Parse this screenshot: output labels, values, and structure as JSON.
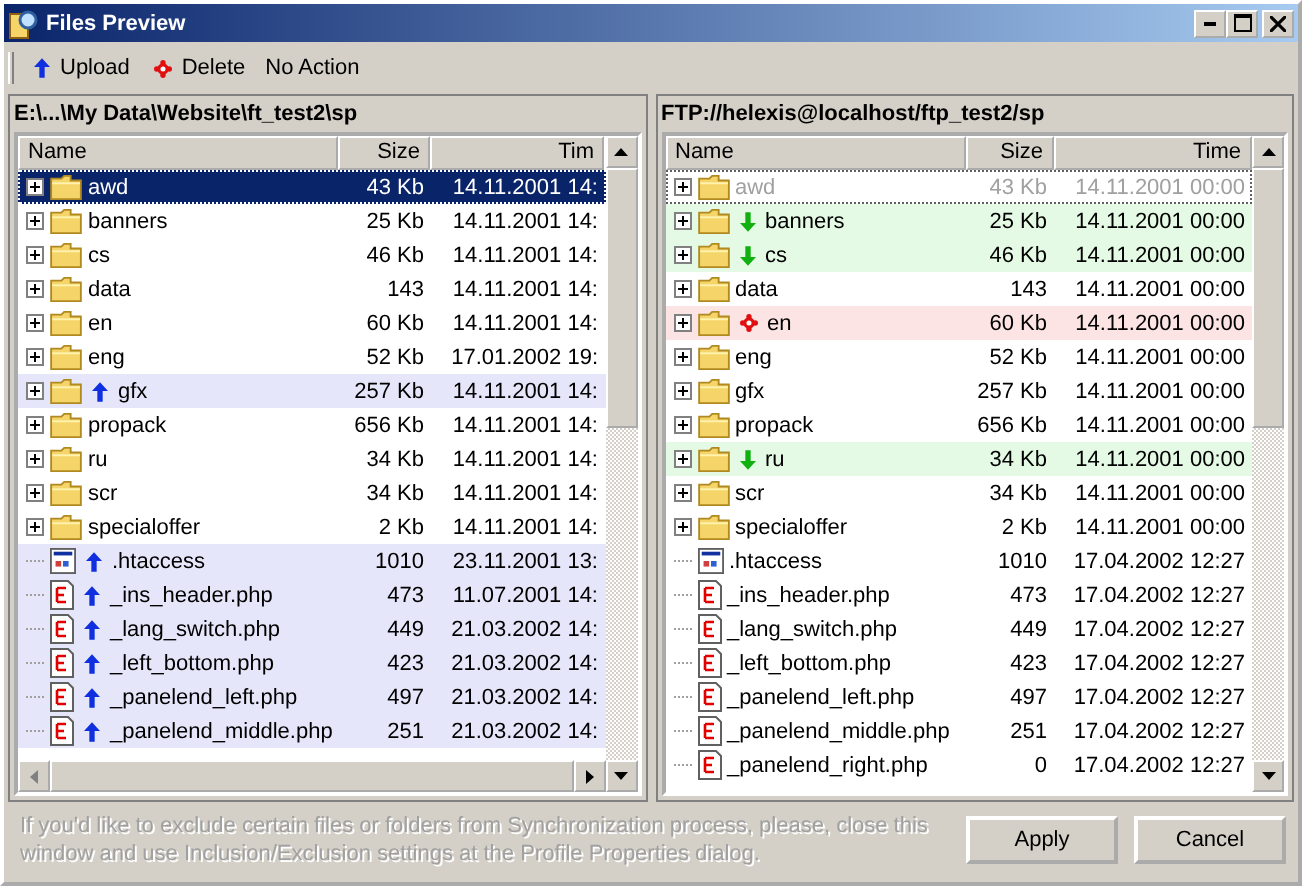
{
  "window": {
    "title": "Files Preview"
  },
  "toolbar": [
    {
      "label": "Upload",
      "kind": "upload"
    },
    {
      "label": "Delete",
      "kind": "delete"
    },
    {
      "label": "No Action",
      "kind": "none"
    }
  ],
  "panes": [
    {
      "path": "E:\\...\\My Data\\Website\\ft_test2\\sp",
      "columns": [
        "Name",
        "Size",
        "Tim"
      ],
      "hscroll": true,
      "rows": [
        {
          "name": "awd",
          "size": "43 Kb",
          "time": "14.11.2001 14:",
          "kind": "folder",
          "selected": true
        },
        {
          "name": "banners",
          "size": "25 Kb",
          "time": "14.11.2001 14:",
          "kind": "folder",
          "selected": false
        },
        {
          "name": "cs",
          "size": "46 Kb",
          "time": "14.11.2001 14:",
          "kind": "folder",
          "selected": false
        },
        {
          "name": "data",
          "size": "143",
          "time": "14.11.2001 14:",
          "kind": "folder",
          "selected": false
        },
        {
          "name": "en",
          "size": "60 Kb",
          "time": "14.11.2001 14:",
          "kind": "folder",
          "selected": false
        },
        {
          "name": "eng",
          "size": "52 Kb",
          "time": "17.01.2002 19:",
          "kind": "folder",
          "selected": false
        },
        {
          "name": "gfx",
          "size": "257 Kb",
          "time": "14.11.2001 14:",
          "kind": "folder",
          "selected": false,
          "action": {
            "kind": "upload"
          }
        },
        {
          "name": "propack",
          "size": "656 Kb",
          "time": "14.11.2001 14:",
          "kind": "folder",
          "selected": false
        },
        {
          "name": "ru",
          "size": "34 Kb",
          "time": "14.11.2001 14:",
          "kind": "folder",
          "selected": false
        },
        {
          "name": "scr",
          "size": "34 Kb",
          "time": "14.11.2001 14:",
          "kind": "folder",
          "selected": false
        },
        {
          "name": "specialoffer",
          "size": "2 Kb",
          "time": "14.11.2001 14:",
          "kind": "folder",
          "selected": false
        },
        {
          "name": ".htaccess",
          "size": "1010",
          "time": "23.11.2001 13:",
          "kind": "config",
          "selected": false,
          "action": {
            "kind": "upload"
          }
        },
        {
          "name": "_ins_header.php",
          "size": "473",
          "time": "11.07.2001 14:",
          "kind": "php",
          "selected": false,
          "action": {
            "kind": "upload"
          }
        },
        {
          "name": "_lang_switch.php",
          "size": "449",
          "time": "21.03.2002 14:",
          "kind": "php",
          "selected": false,
          "action": {
            "kind": "upload"
          }
        },
        {
          "name": "_left_bottom.php",
          "size": "423",
          "time": "21.03.2002 14:",
          "kind": "php",
          "selected": false,
          "action": {
            "kind": "upload"
          }
        },
        {
          "name": "_panelend_left.php",
          "size": "497",
          "time": "21.03.2002 14:",
          "kind": "php",
          "selected": false,
          "action": {
            "kind": "upload"
          }
        },
        {
          "name": "_panelend_middle.php",
          "size": "251",
          "time": "21.03.2002 14:",
          "kind": "php",
          "selected": false,
          "action": {
            "kind": "upload"
          }
        }
      ]
    },
    {
      "path": "FTP://helexis@localhost/ftp_test2/sp",
      "columns": [
        "Name",
        "Size",
        "Time"
      ],
      "hscroll": false,
      "rows": [
        {
          "name": "awd",
          "size": "43 Kb",
          "time": "14.11.2001 00:00",
          "kind": "folder",
          "selected": false,
          "disabled": true
        },
        {
          "name": "banners",
          "size": "25 Kb",
          "time": "14.11.2001 00:00",
          "kind": "folder",
          "selected": false,
          "disabled": false,
          "action": {
            "kind": "download"
          }
        },
        {
          "name": "cs",
          "size": "46 Kb",
          "time": "14.11.2001 00:00",
          "kind": "folder",
          "selected": false,
          "disabled": false,
          "action": {
            "kind": "download"
          }
        },
        {
          "name": "data",
          "size": "143",
          "time": "14.11.2001 00:00",
          "kind": "folder",
          "selected": false,
          "disabled": false
        },
        {
          "name": "en",
          "size": "60 Kb",
          "time": "14.11.2001 00:00",
          "kind": "folder",
          "selected": false,
          "disabled": false,
          "action": {
            "kind": "delete"
          }
        },
        {
          "name": "eng",
          "size": "52 Kb",
          "time": "14.11.2001 00:00",
          "kind": "folder",
          "selected": false,
          "disabled": false
        },
        {
          "name": "gfx",
          "size": "257 Kb",
          "time": "14.11.2001 00:00",
          "kind": "folder",
          "selected": false,
          "disabled": false
        },
        {
          "name": "propack",
          "size": "656 Kb",
          "time": "14.11.2001 00:00",
          "kind": "folder",
          "selected": false,
          "disabled": false
        },
        {
          "name": "ru",
          "size": "34 Kb",
          "time": "14.11.2001 00:00",
          "kind": "folder",
          "selected": false,
          "disabled": false,
          "action": {
            "kind": "download"
          }
        },
        {
          "name": "scr",
          "size": "34 Kb",
          "time": "14.11.2001 00:00",
          "kind": "folder",
          "selected": false,
          "disabled": false
        },
        {
          "name": "specialoffer",
          "size": "2 Kb",
          "time": "14.11.2001 00:00",
          "kind": "folder",
          "selected": false,
          "disabled": false
        },
        {
          "name": ".htaccess",
          "size": "1010",
          "time": "17.04.2002 12:27",
          "kind": "config",
          "selected": false,
          "disabled": false
        },
        {
          "name": "_ins_header.php",
          "size": "473",
          "time": "17.04.2002 12:27",
          "kind": "php",
          "selected": false,
          "disabled": false
        },
        {
          "name": "_lang_switch.php",
          "size": "449",
          "time": "17.04.2002 12:27",
          "kind": "php",
          "selected": false,
          "disabled": false
        },
        {
          "name": "_left_bottom.php",
          "size": "423",
          "time": "17.04.2002 12:27",
          "kind": "php",
          "selected": false,
          "disabled": false
        },
        {
          "name": "_panelend_left.php",
          "size": "497",
          "time": "17.04.2002 12:27",
          "kind": "php",
          "selected": false,
          "disabled": false
        },
        {
          "name": "_panelend_middle.php",
          "size": "251",
          "time": "17.04.2002 12:27",
          "kind": "php",
          "selected": false,
          "disabled": false
        },
        {
          "name": "_panelend_right.php",
          "size": "0",
          "time": "17.04.2002 12:27",
          "kind": "php",
          "selected": false,
          "disabled": false
        }
      ]
    }
  ],
  "note": "If you'd like to exclude certain files or folders from Synchronization process, please, close this window and use Inclusion/Exclusion settings at the Profile Properties dialog.",
  "buttons": [
    "Apply",
    "Cancel"
  ]
}
